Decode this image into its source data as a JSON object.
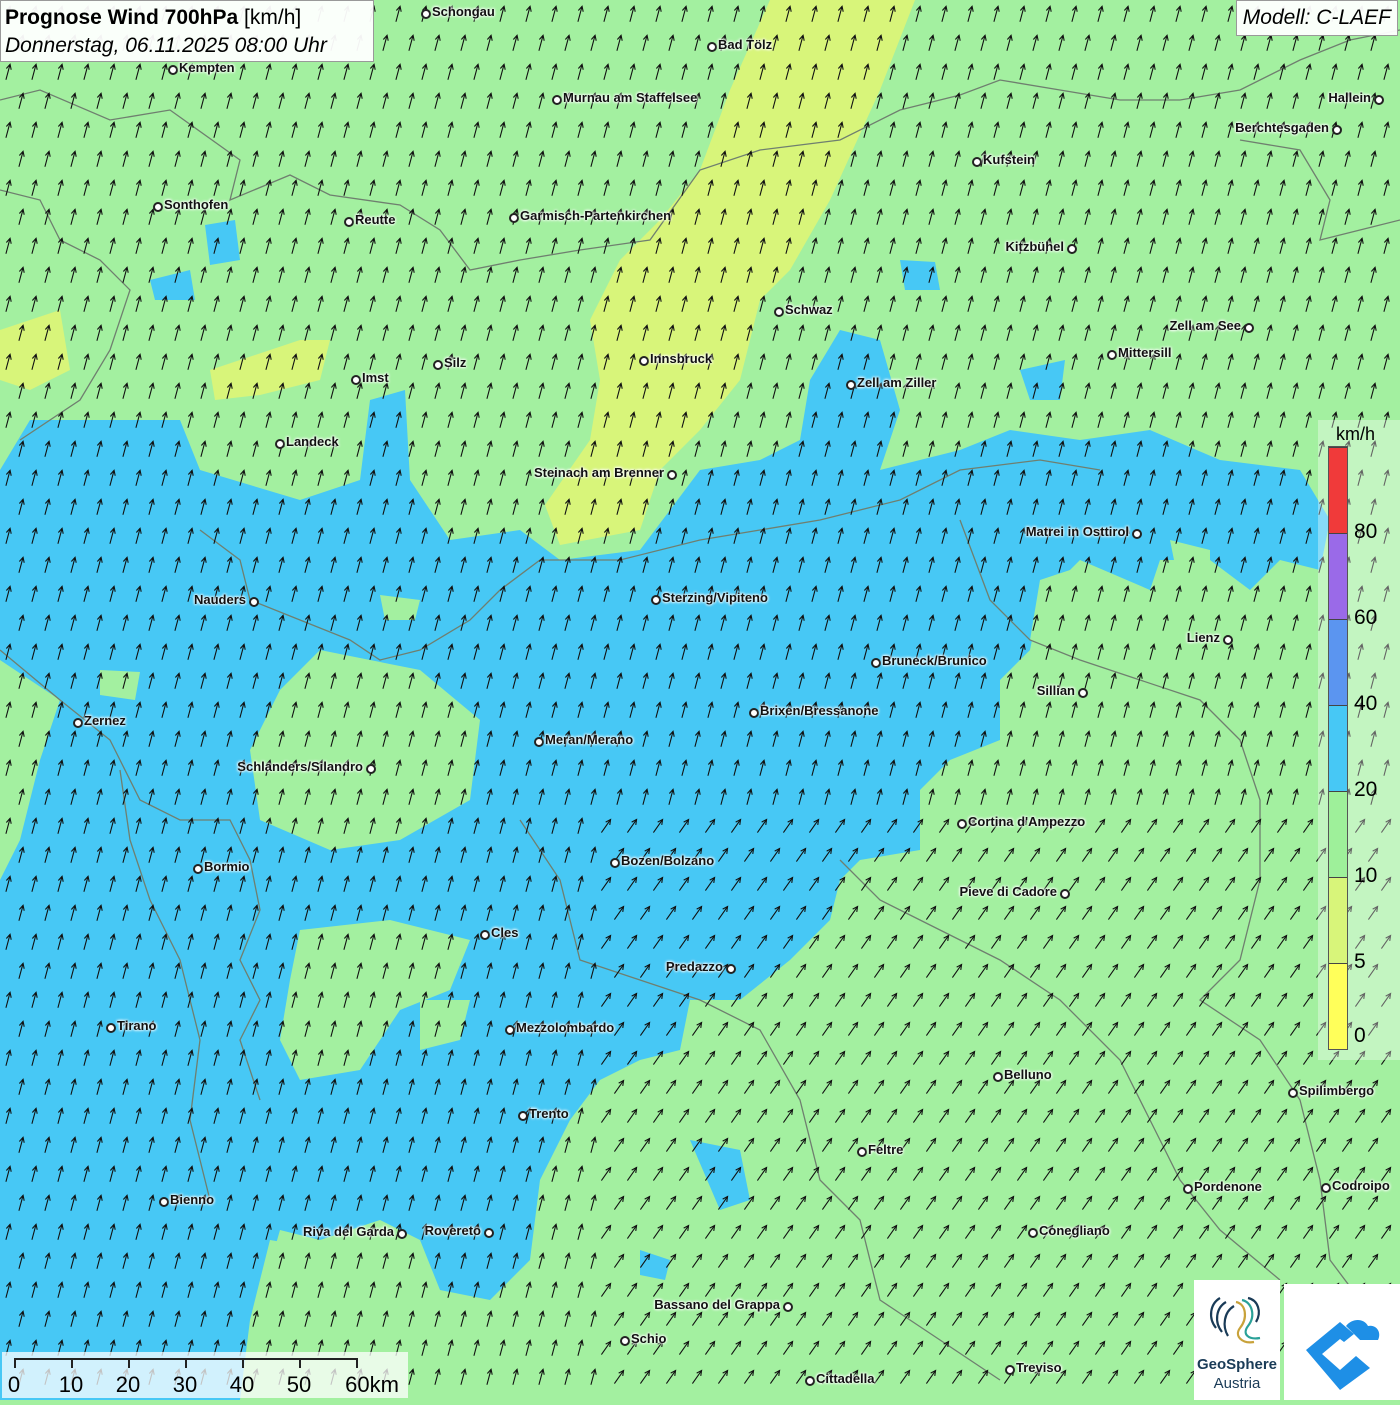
{
  "header": {
    "title_bold": "Prognose Wind 700hPa",
    "title_unit": "[km/h]",
    "datetime": "Donnerstag, 06.11.2025 08:00 Uhr"
  },
  "model": {
    "label": "Modell: C-LAEF"
  },
  "legend": {
    "unit": "km/h",
    "stops": [
      {
        "label": "0",
        "color": "#ffff5a"
      },
      {
        "label": "5",
        "color": "#d8f57a"
      },
      {
        "label": "10",
        "color": "#9ef09a"
      },
      {
        "label": "20",
        "color": "#47c8f5"
      },
      {
        "label": "40",
        "color": "#5b95f0"
      },
      {
        "label": "60",
        "color": "#9a6ae8"
      },
      {
        "label": "80",
        "color": "#f03a3a"
      }
    ]
  },
  "scalebar": {
    "labels": [
      "0",
      "10",
      "20",
      "30",
      "40",
      "50",
      "60km"
    ]
  },
  "logos": {
    "geosphere_line1": "GeoSphere",
    "geosphere_line2": "Austria"
  },
  "colors": {
    "background_green": "#a3f0a0",
    "wind_blue": "#47c8f5",
    "wind_yellow": "#d8f57a",
    "border_gray": "#6f7f6f",
    "arrow": "#111111"
  },
  "cities": [
    {
      "name": "Schongau",
      "side": "right"
    },
    {
      "name": "Bad Tölz",
      "side": "right"
    },
    {
      "name": "Kempten",
      "side": "right"
    },
    {
      "name": "Murnau am Staffelsee",
      "side": "right"
    },
    {
      "name": "Hallein",
      "side": "left"
    },
    {
      "name": "Berchtesgaden",
      "side": "left"
    },
    {
      "name": "Kufstein",
      "side": "right"
    },
    {
      "name": "Sonthofen",
      "side": "right"
    },
    {
      "name": "Reutte",
      "side": "right"
    },
    {
      "name": "Garmisch-Partenkirchen",
      "side": "right"
    },
    {
      "name": "Kitzbühel",
      "side": "left"
    },
    {
      "name": "Schwaz",
      "side": "right"
    },
    {
      "name": "Zell am See",
      "side": "left"
    },
    {
      "name": "Mittersill",
      "side": "right"
    },
    {
      "name": "Innsbruck",
      "side": "right"
    },
    {
      "name": "Silz",
      "side": "right"
    },
    {
      "name": "Imst",
      "side": "right"
    },
    {
      "name": "Zell am Ziller",
      "side": "right"
    },
    {
      "name": "Landeck",
      "side": "right"
    },
    {
      "name": "Steinach am Brenner",
      "side": "left"
    },
    {
      "name": "Matrei in Osttirol",
      "side": "left"
    },
    {
      "name": "Nauders",
      "side": "left"
    },
    {
      "name": "Sterzing/Vipiteno",
      "side": "right"
    },
    {
      "name": "Lienz",
      "side": "left"
    },
    {
      "name": "Bruneck/Brunico",
      "side": "right"
    },
    {
      "name": "Sillian",
      "side": "left"
    },
    {
      "name": "Zernez",
      "side": "right"
    },
    {
      "name": "Brixen/Bressanone",
      "side": "right"
    },
    {
      "name": "Meran/Merano",
      "side": "right"
    },
    {
      "name": "Schlanders/Silandro",
      "side": "left"
    },
    {
      "name": "Cortina d'Ampezzo",
      "side": "right"
    },
    {
      "name": "Bozen/Bolzano",
      "side": "right"
    },
    {
      "name": "Bormio",
      "side": "right"
    },
    {
      "name": "Pieve di Cadore",
      "side": "left"
    },
    {
      "name": "Cles",
      "side": "right"
    },
    {
      "name": "Predazzo",
      "side": "left"
    },
    {
      "name": "Tirano",
      "side": "right"
    },
    {
      "name": "Mezzolombardo",
      "side": "right"
    },
    {
      "name": "Belluno",
      "side": "right"
    },
    {
      "name": "Spilimbergo",
      "side": "right"
    },
    {
      "name": "Trento",
      "side": "right"
    },
    {
      "name": "Feltre",
      "side": "right"
    },
    {
      "name": "Pordenone",
      "side": "right"
    },
    {
      "name": "Codroipo",
      "side": "right"
    },
    {
      "name": "Bienno",
      "side": "right"
    },
    {
      "name": "Riva del Garda",
      "side": "left"
    },
    {
      "name": "Rovereto",
      "side": "left"
    },
    {
      "name": "Conegliano",
      "side": "right"
    },
    {
      "name": "Bassano del Grappa",
      "side": "left"
    },
    {
      "name": "Schio",
      "side": "right"
    },
    {
      "name": "Treviso",
      "side": "right"
    },
    {
      "name": "Cittadella",
      "side": "right"
    }
  ]
}
